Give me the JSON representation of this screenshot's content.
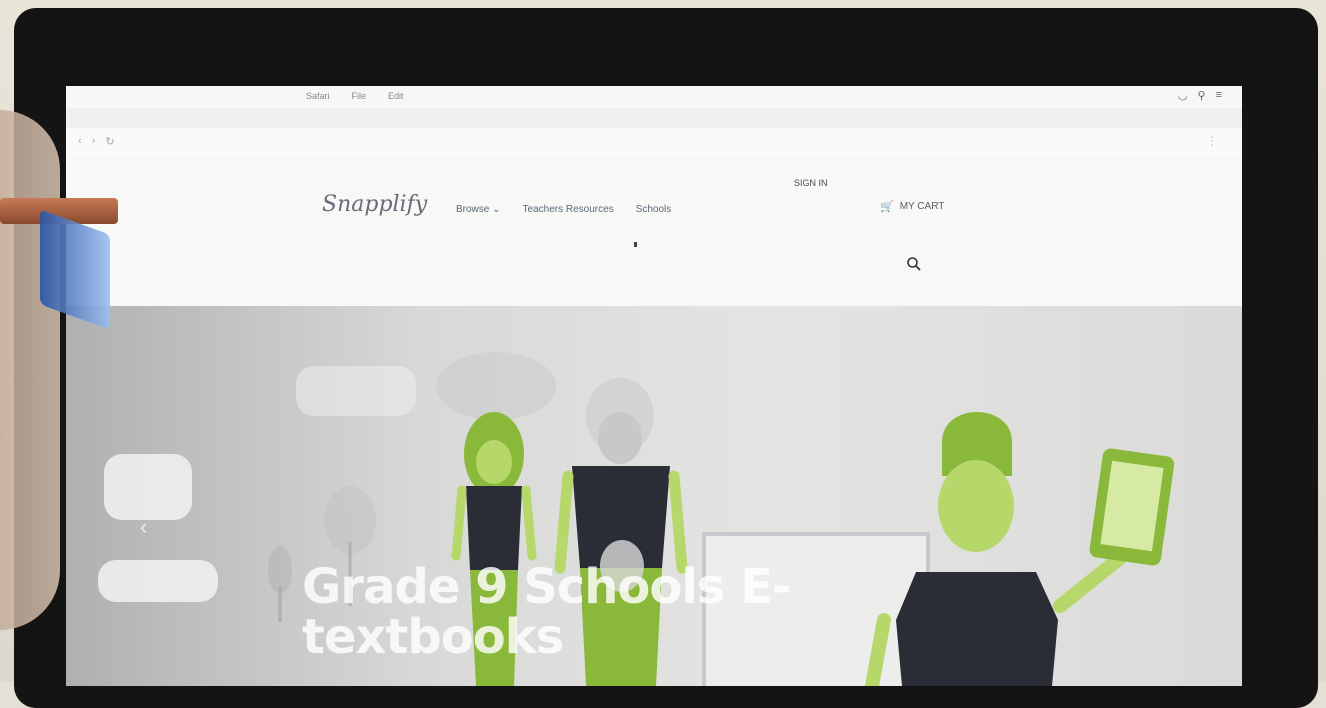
{
  "browser": {
    "menu_items": [
      "Safari",
      "File",
      "Edit"
    ],
    "status_items": [
      "",
      "",
      "",
      ""
    ],
    "url": ""
  },
  "site": {
    "logo": "Snapplify",
    "nav": [
      "Browse ⌄",
      "Teachers Resources",
      "Schools"
    ],
    "account": "SIGN IN",
    "cart": "MY CART",
    "search_placeholder": ""
  },
  "hero": {
    "title_line1": "Grade 9 Schools E-",
    "title_line2": "textbooks"
  },
  "colors": {
    "accent_green": "#8ab83a",
    "shirt_dark": "#2a2d36"
  }
}
